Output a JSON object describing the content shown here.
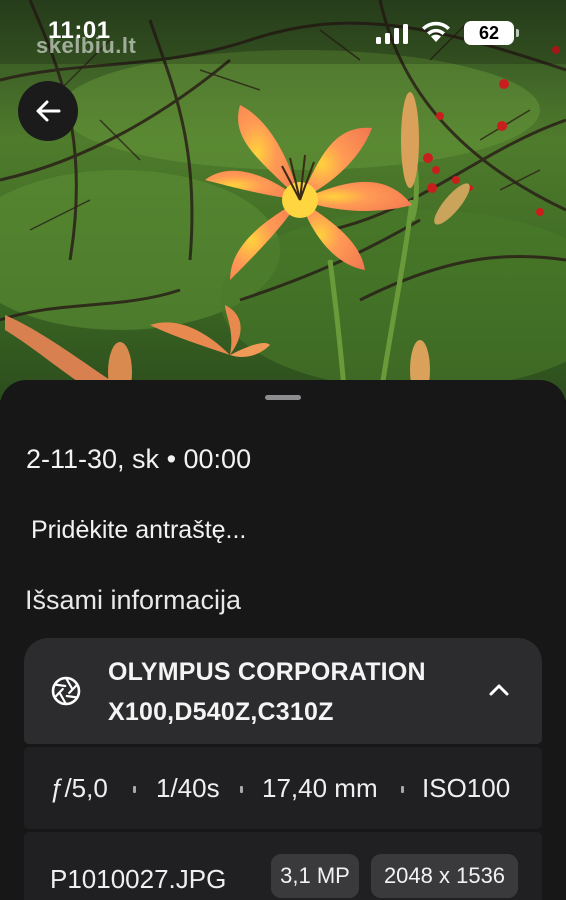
{
  "status_bar": {
    "time": "11:01",
    "battery": "62",
    "watermark": "skelbiu.lt"
  },
  "photo": {
    "subject": "orange day lily flower photo"
  },
  "sheet": {
    "datetime": "2-11-30, sk • 00:00",
    "caption_placeholder": "Pridėkite antraštę...",
    "details_heading": "Išsami informacija",
    "camera": {
      "line1": "OLYMPUS CORPORATION",
      "line2": "X100,D540Z,C310Z"
    },
    "exposure": {
      "aperture": "ƒ/5,0",
      "shutter": "1/40s",
      "focal_length": "17,40 mm",
      "iso": "ISO100"
    },
    "file": {
      "name": "P1010027.JPG",
      "megapixels": "3,1 MP",
      "resolution": "2048 x 1536"
    }
  },
  "icons": {
    "back": "arrow-back-icon",
    "aperture": "aperture-icon",
    "collapse": "chevron-up-icon"
  },
  "colors": {
    "sheet_bg": "#171718",
    "card_primary": "#2c2c2e",
    "card_secondary": "#202022",
    "chip_bg": "#3a3a3c"
  }
}
